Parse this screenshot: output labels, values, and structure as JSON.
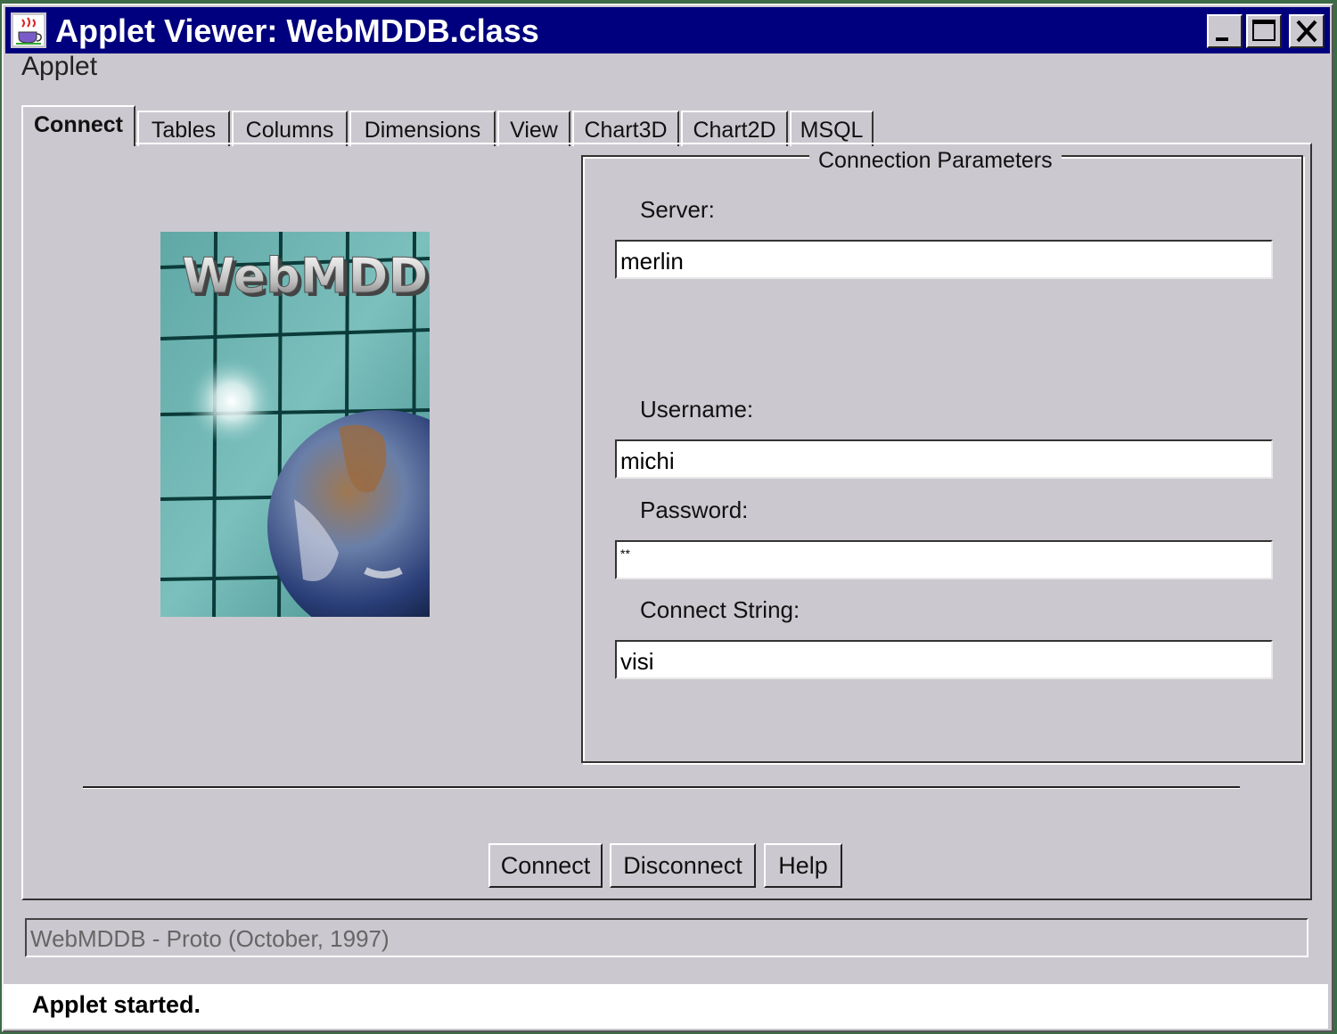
{
  "window": {
    "title": "Applet Viewer: WebMDDB.class",
    "icons": {
      "app": "java-cup-icon",
      "minimize": "minimize-icon",
      "maximize": "maximize-icon",
      "close": "close-icon"
    }
  },
  "menu": {
    "applet": "Applet"
  },
  "tabs": [
    {
      "label": "Connect",
      "active": true
    },
    {
      "label": "Tables"
    },
    {
      "label": "Columns"
    },
    {
      "label": "Dimensions"
    },
    {
      "label": "View"
    },
    {
      "label": "Chart3D"
    },
    {
      "label": "Chart2D"
    },
    {
      "label": "MSQL"
    }
  ],
  "logo": {
    "text": "WebMDDB"
  },
  "connection": {
    "legend": "Connection Parameters",
    "server_label": "Server:",
    "server_value": "merlin",
    "username_label": "Username:",
    "username_value": "michi",
    "password_label": "Password:",
    "password_value": "**",
    "connect_string_label": "Connect String:",
    "connect_string_value": "visi"
  },
  "buttons": {
    "connect": "Connect",
    "disconnect": "Disconnect",
    "help": "Help"
  },
  "info": "WebMDDB - Proto (October, 1997)",
  "status": "Applet started."
}
